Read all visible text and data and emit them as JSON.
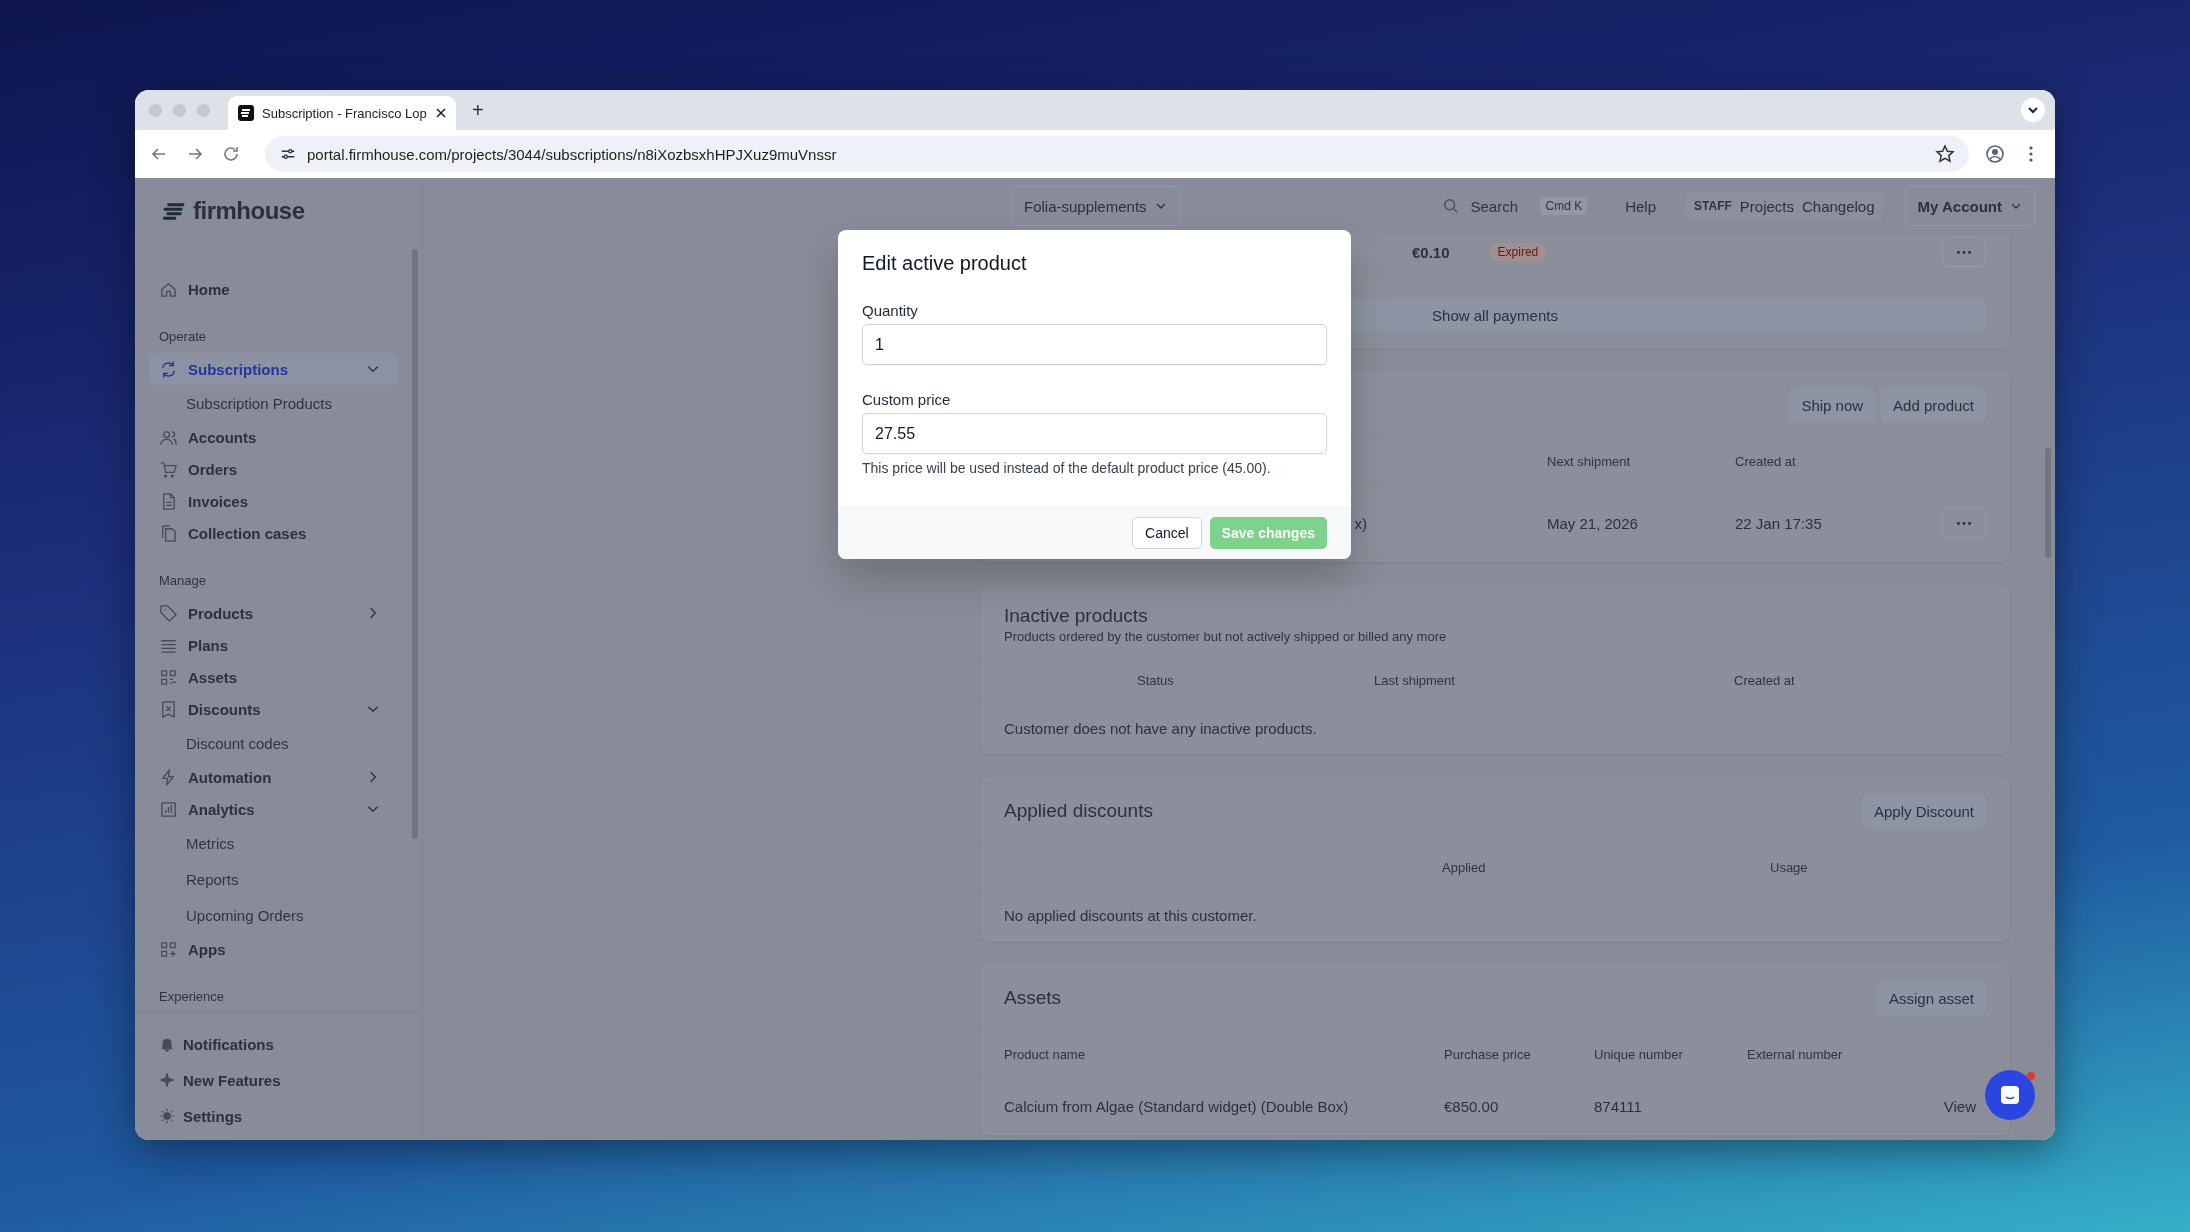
{
  "browser": {
    "tab_title": "Subscription - Francisco Lop",
    "new_tab": "+",
    "url": "portal.firmhouse.com/projects/3044/subscriptions/n8iXozbsxhHPJXuz9muVnssr"
  },
  "sidebar": {
    "logo": "firmhouse",
    "sections": [
      {
        "items": [
          {
            "label": "Home",
            "selected": false
          }
        ]
      },
      {
        "heading": "Operate",
        "items": [
          {
            "label": "Subscriptions",
            "selected": true,
            "expanded": true,
            "children": [
              {
                "label": "Subscription Products",
                "selected": false
              }
            ]
          },
          {
            "label": "Accounts",
            "selected": false
          },
          {
            "label": "Orders",
            "selected": false
          },
          {
            "label": "Invoices",
            "selected": false
          },
          {
            "label": "Collection cases",
            "selected": false
          }
        ]
      },
      {
        "heading": "Manage",
        "items": [
          {
            "label": "Products",
            "selected": false,
            "expanded": false
          },
          {
            "label": "Plans",
            "selected": false
          },
          {
            "label": "Assets",
            "selected": false
          },
          {
            "label": "Discounts",
            "selected": false,
            "expanded": true,
            "children": [
              {
                "label": "Discount codes",
                "selected": false
              }
            ]
          },
          {
            "label": "Automation",
            "selected": false,
            "expanded": false
          },
          {
            "label": "Analytics",
            "selected": false,
            "expanded": true,
            "children": [
              {
                "label": "Metrics",
                "selected": false
              },
              {
                "label": "Reports",
                "selected": false
              },
              {
                "label": "Upcoming Orders",
                "selected": false
              }
            ]
          },
          {
            "label": "Apps",
            "selected": false
          }
        ]
      },
      {
        "heading": "Experience"
      }
    ],
    "footer_items": [
      {
        "label": "Notifications",
        "selected": false
      },
      {
        "label": "New Features",
        "selected": false
      },
      {
        "label": "Settings",
        "selected": false
      }
    ]
  },
  "header": {
    "project": "Folia-supplements",
    "search": {
      "placeholder": "Search",
      "shortcut": "Cmd K"
    },
    "help": "Help",
    "staff_badge": "STAFF",
    "links": [
      "Projects",
      "Changelog"
    ],
    "account": "My Account"
  },
  "payments": {
    "amount": "€0.10",
    "status": "Expired",
    "show_all": "Show all payments"
  },
  "active_products": {
    "buttons": [
      "Ship now",
      "Add product"
    ],
    "columns": [
      "Next shipment",
      "Created at"
    ],
    "rows": [
      {
        "product": "x)",
        "next_shipment": "May 21, 2026",
        "created_at": "22 Jan 17:35"
      }
    ]
  },
  "inactive_products": {
    "title": "Inactive products",
    "subtitle": "Products ordered by the customer but not actively shipped or billed any more",
    "columns": [
      "Status",
      "Last shipment",
      "Created at"
    ],
    "empty": "Customer does not have any inactive products."
  },
  "applied_discounts": {
    "title": "Applied discounts",
    "button": "Apply Discount",
    "columns": [
      "Applied",
      "Usage"
    ],
    "empty": "No applied discounts at this customer."
  },
  "assets": {
    "title": "Assets",
    "button": "Assign asset",
    "columns": [
      "Product name",
      "Purchase price",
      "Unique number",
      "External number"
    ],
    "rows": [
      {
        "product_name": "Calcium from Algae (Standard widget) (Double Box)",
        "purchase_price": "€850.00",
        "unique_number": "874111",
        "action": "View"
      }
    ]
  },
  "dialog": {
    "title": "Edit active product",
    "fields": [
      {
        "label": "Quantity",
        "value": "1"
      },
      {
        "label": "Custom price",
        "value": "27.55",
        "hint": "This price will be used instead of the default product price (45.00)."
      }
    ],
    "cancel": "Cancel",
    "save": "Save changes"
  }
}
